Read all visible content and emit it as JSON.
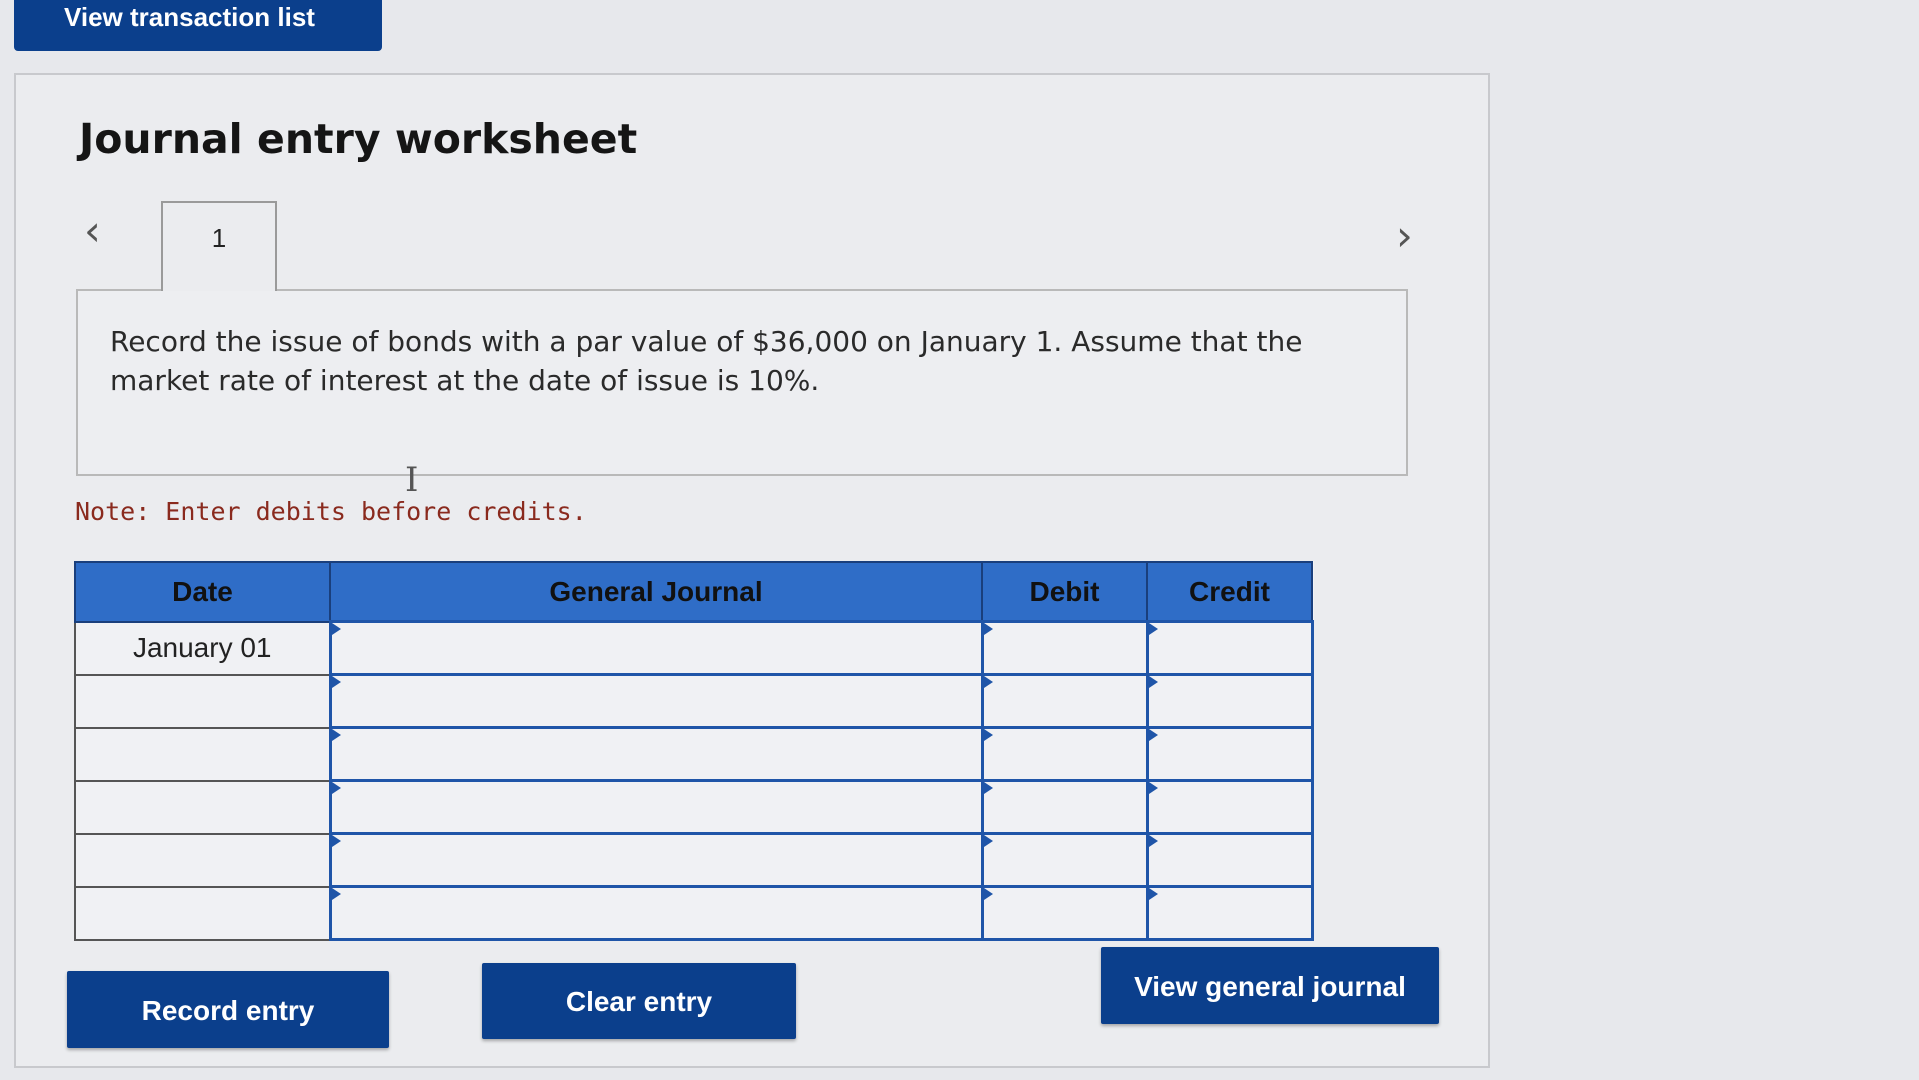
{
  "header": {
    "transaction_list_button": "View transaction list"
  },
  "worksheet": {
    "title": "Journal entry worksheet",
    "tabs": [
      {
        "label": "1"
      }
    ],
    "description": "Record the issue of bonds with a par value of $36,000 on January 1. Assume that the market rate of interest at the date of issue is 10%.",
    "note": "Note: Enter debits before credits."
  },
  "icons": {
    "prev": "chevron-left-icon",
    "next": "chevron-right-icon",
    "cursor": "text-cursor-icon"
  },
  "table": {
    "headers": {
      "date": "Date",
      "general_journal": "General Journal",
      "debit": "Debit",
      "credit": "Credit"
    },
    "rows": [
      {
        "date": "January 01",
        "general_journal": "",
        "debit": "",
        "credit": ""
      },
      {
        "date": "",
        "general_journal": "",
        "debit": "",
        "credit": ""
      },
      {
        "date": "",
        "general_journal": "",
        "debit": "",
        "credit": ""
      },
      {
        "date": "",
        "general_journal": "",
        "debit": "",
        "credit": ""
      },
      {
        "date": "",
        "general_journal": "",
        "debit": "",
        "credit": ""
      },
      {
        "date": "",
        "general_journal": "",
        "debit": "",
        "credit": ""
      }
    ]
  },
  "buttons": {
    "record": "Record entry",
    "clear": "Clear entry",
    "view_general_journal": "View general journal"
  },
  "colors": {
    "primary_button": "#0b3f8c",
    "table_header": "#2f6dc7",
    "note_text": "#8a2a1e"
  }
}
